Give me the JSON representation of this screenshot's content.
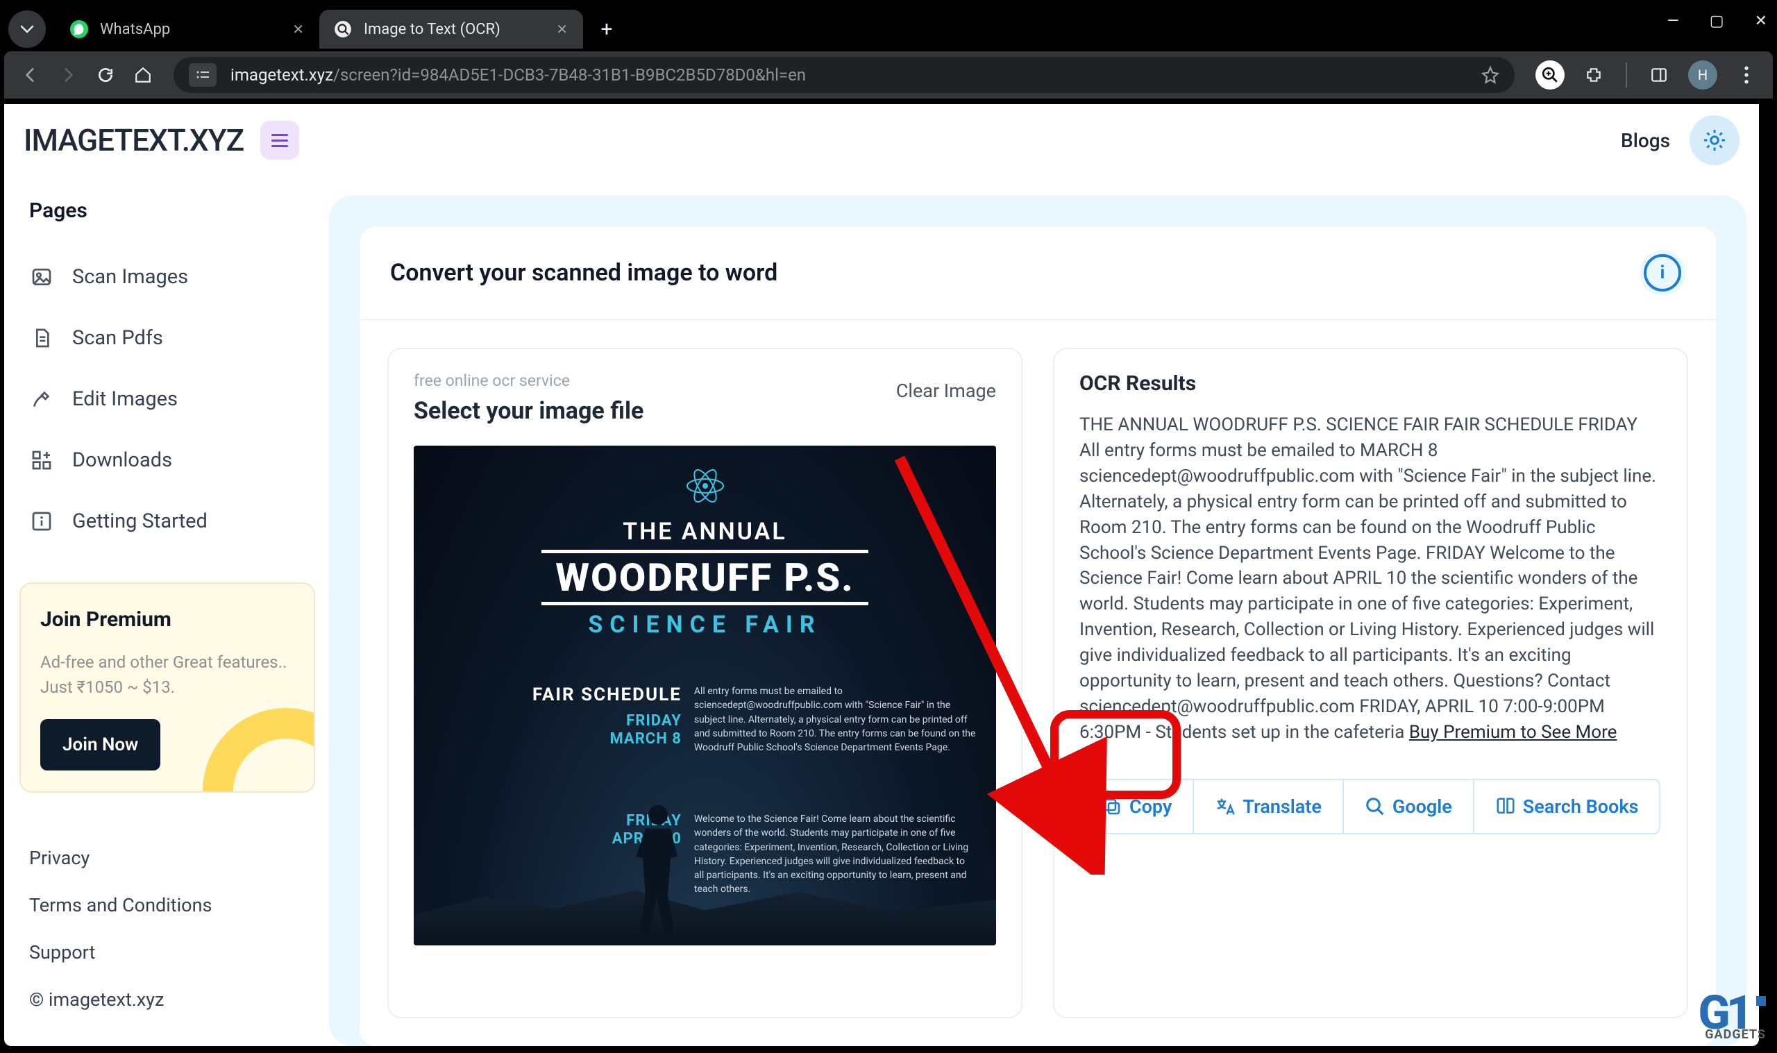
{
  "browser": {
    "tabs": [
      {
        "title": "WhatsApp",
        "active": false
      },
      {
        "title": "Image to Text (OCR)",
        "active": true
      }
    ],
    "url_host": "imagetext.xyz",
    "url_path": "/screen?id=984AD5E1-DCB3-7B48-31B1-B9BC2B5D78D0&hl=en",
    "avatar_letter": "H"
  },
  "header": {
    "brand": "IMAGETEXT.XYZ",
    "blogs": "Blogs"
  },
  "sidebar": {
    "section_title": "Pages",
    "items": [
      {
        "label": "Scan Images"
      },
      {
        "label": "Scan Pdfs"
      },
      {
        "label": "Edit Images"
      },
      {
        "label": "Downloads"
      },
      {
        "label": "Getting Started"
      }
    ],
    "promo": {
      "title": "Join Premium",
      "desc_line1": "Ad-free and other Great features..",
      "desc_line2": "Just ₹1050 ~ $13.",
      "cta": "Join Now"
    },
    "footer": {
      "privacy": "Privacy",
      "terms": "Terms and Conditions",
      "support": "Support",
      "copyright": "© imagetext.xyz"
    }
  },
  "workbench": {
    "title": "Convert your scanned image to word",
    "left": {
      "subtle": "free online ocr service",
      "heading": "Select your image file",
      "clear": "Clear Image",
      "poster": {
        "l1": "THE ANNUAL",
        "l2": "WOODRUFF P.S.",
        "l3": "SCIENCE FAIR",
        "schedule": "FAIR SCHEDULE",
        "date1a": "FRIDAY",
        "date1b": "MARCH 8",
        "para1": "All entry forms must be emailed to sciencedept@woodruffpublic.com with \"Science Fair\" in the subject line. Alternately, a physical entry form can be printed off and submitted to Room 210. The entry forms can be found on the Woodruff Public School's Science Department Events Page.",
        "date2a": "FRIDAY",
        "date2b": "APRIL 10",
        "para2": "Welcome to the Science Fair! Come learn about the scientific wonders of the world. Students may participate in one of five categories: Experiment, Invention, Research, Collection or Living History. Experienced judges will give individualized feedback to all participants. It's an exciting opportunity to learn, present and teach others."
      }
    },
    "right": {
      "title": "OCR Results",
      "text": "THE ANNUAL WOODRUFF P.S. SCIENCE FAIR FAIR SCHEDULE FRIDAY All entry forms must be emailed to MARCH 8 sciencedept@woodruffpublic.com with \"Science Fair\" in the subject line. Alternately, a physical entry form can be printed off and submitted to Room 210. The entry forms can be found on the Woodruff Public School's Science Department Events Page. FRIDAY Welcome to the Science Fair! Come learn about APRIL 10 the scientific wonders of the world. Students may participate in one of five categories: Experiment, Invention, Research, Collection or Living History. Experienced judges will give individualized feedback to all participants. It's an exciting opportunity to learn, present and teach others. Questions? Contact sciencedept@woodruffpublic.com FRIDAY, APRIL 10 7:00-9:00PM 6:30PM - Students set up in the cafeteria",
      "link": "Buy Premium to See More",
      "actions": {
        "copy": "Copy",
        "translate": "Translate",
        "google": "Google",
        "searchbooks": "Search Books"
      }
    }
  },
  "badge": {
    "g1": "G1",
    "text": "GADGETS"
  }
}
